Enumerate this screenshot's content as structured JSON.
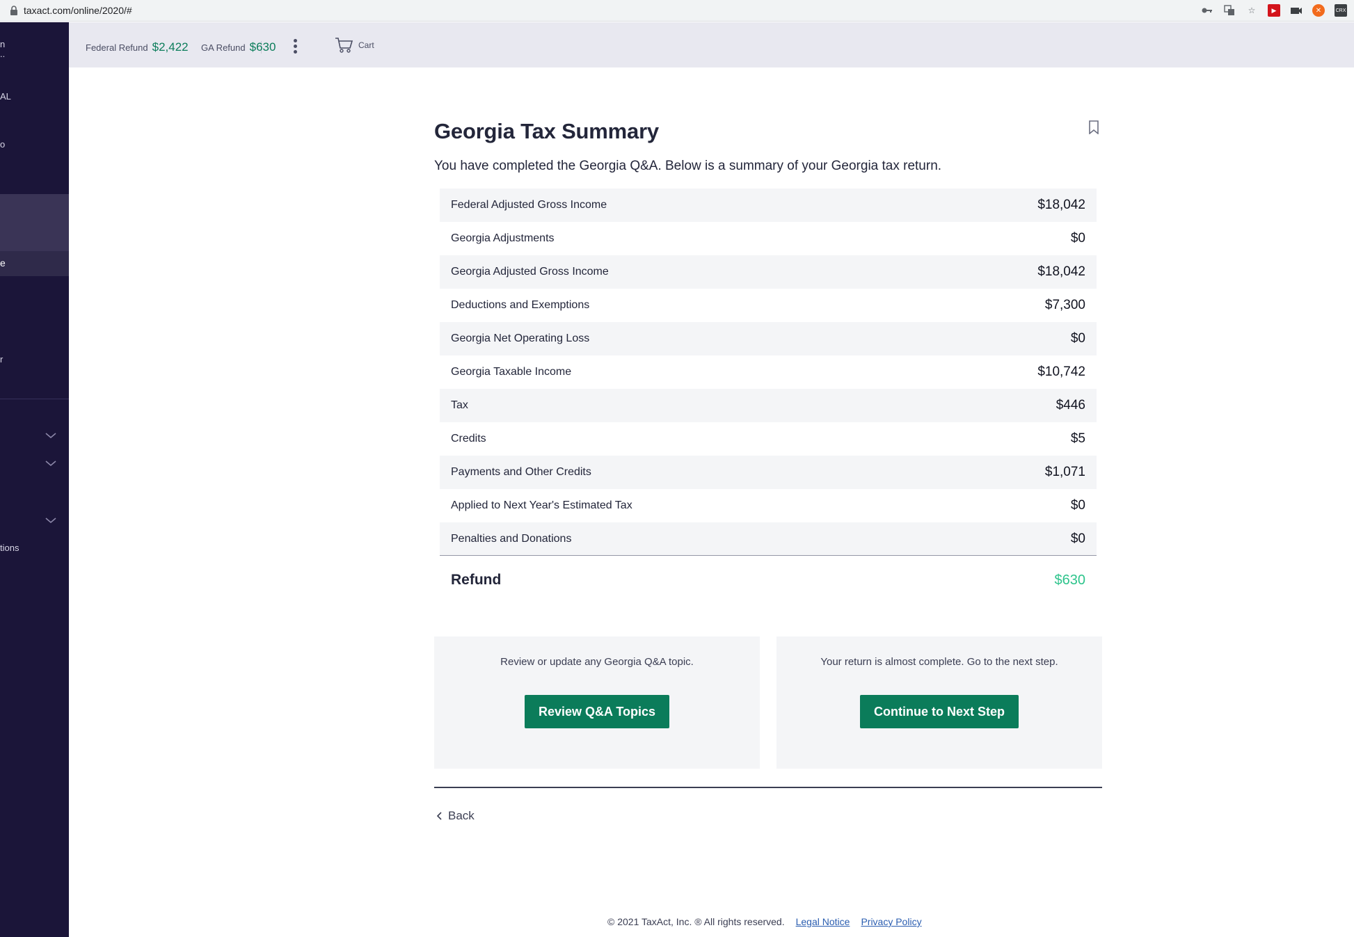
{
  "browser": {
    "url": "taxact.com/online/2020/#",
    "extensions": [
      "key-icon",
      "translate-icon",
      "star-icon",
      "youtube-icon",
      "camera-icon",
      "orange-circle-icon",
      "crx-icon"
    ],
    "crx_label": "CRX"
  },
  "sidebar": {
    "fragments": [
      "n",
      "..",
      "AL",
      "o",
      "e",
      "r",
      "tions"
    ]
  },
  "header": {
    "federal_refund_label": "Federal Refund",
    "federal_refund_value": "$2,422",
    "ga_refund_label": "GA Refund",
    "ga_refund_value": "$630",
    "cart_label": "Cart"
  },
  "page": {
    "title": "Georgia Tax Summary",
    "subtitle": "You have completed the Georgia Q&A. Below is a summary of your Georgia tax return."
  },
  "summary": {
    "rows": [
      {
        "label": "Federal Adjusted Gross Income",
        "value": "$18,042"
      },
      {
        "label": "Georgia Adjustments",
        "value": "$0"
      },
      {
        "label": "Georgia Adjusted Gross Income",
        "value": "$18,042"
      },
      {
        "label": "Deductions and Exemptions",
        "value": "$7,300"
      },
      {
        "label": "Georgia Net Operating Loss",
        "value": "$0"
      },
      {
        "label": "Georgia Taxable Income",
        "value": "$10,742"
      },
      {
        "label": "Tax",
        "value": "$446"
      },
      {
        "label": "Credits",
        "value": "$5"
      },
      {
        "label": "Payments and Other Credits",
        "value": "$1,071"
      },
      {
        "label": "Applied to Next Year's Estimated Tax",
        "value": "$0"
      },
      {
        "label": "Penalties and Donations",
        "value": "$0"
      }
    ],
    "refund_label": "Refund",
    "refund_value": "$630"
  },
  "cards": {
    "review_text": "Review or update any Georgia Q&A topic.",
    "review_button": "Review Q&A Topics",
    "continue_text": "Your return is almost complete. Go to the next step.",
    "continue_button": "Continue to Next Step"
  },
  "nav": {
    "back_label": "Back"
  },
  "footer": {
    "copyright": "© 2021 TaxAct, Inc. ® All rights reserved.",
    "legal_notice": "Legal Notice",
    "privacy_policy": "Privacy Policy"
  },
  "colors": {
    "sidebar_bg": "#1b1539",
    "accent_green": "#0b7c5a",
    "refund_green": "#2ec48c",
    "header_bg": "#e8e8f0"
  }
}
